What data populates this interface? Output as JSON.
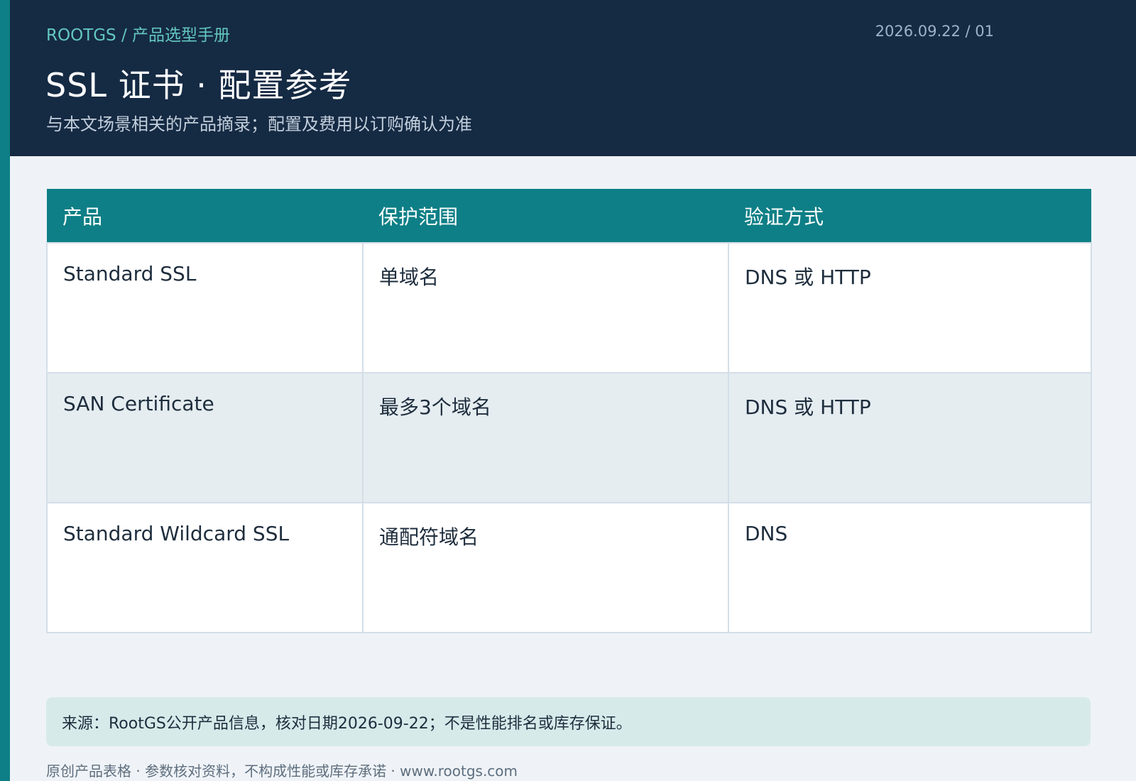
{
  "header": {
    "breadcrumb": "ROOTGS / 产品选型手册",
    "date": "2026.09.22 / 01",
    "title": "SSL 证书 · 配置参考",
    "subtitle": "与本文场景相关的产品摘录；配置及费用以订购确认为准"
  },
  "table": {
    "columns": [
      "产品",
      "保护范围",
      "验证方式"
    ],
    "rows": [
      [
        "Standard SSL",
        "单域名",
        "DNS 或 HTTP"
      ],
      [
        "SAN Certificate",
        "最多3个域名",
        "DNS 或 HTTP"
      ],
      [
        "Standard Wildcard SSL",
        "通配符域名",
        "DNS"
      ]
    ]
  },
  "source_note": "来源：RootGS公开产品信息，核对日期2026-09-22；不是性能排名或库存保证。",
  "footer": "原创产品表格 · 参数核对资料，不构成性能或库存承诺 · www.rootgs.com",
  "colors": {
    "header_bg": "#152a43",
    "accent": "#0e7f86",
    "breadcrumb": "#63c7bf",
    "page_bg": "#eff3f7",
    "note_bg": "#d7eaea"
  }
}
